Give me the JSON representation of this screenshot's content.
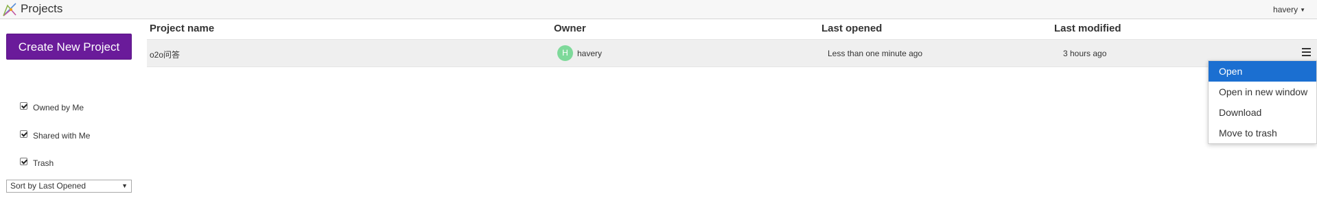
{
  "header": {
    "title": "Projects",
    "user": "havery",
    "logo_icon": "projects-logo-icon"
  },
  "sidebar": {
    "create_button": "Create New Project",
    "filters": [
      {
        "label": "Owned by Me",
        "checked": true
      },
      {
        "label": "Shared with Me",
        "checked": true
      },
      {
        "label": "Trash",
        "checked": true
      }
    ],
    "sort": {
      "selected": "Sort by Last Opened"
    }
  },
  "table": {
    "columns": [
      "Project name",
      "Owner",
      "Last opened",
      "Last modified"
    ],
    "rows": [
      {
        "name": "o2o问答",
        "owner_initial": "H",
        "owner": "havery",
        "last_opened": "Less than one minute ago",
        "last_modified": "3 hours ago"
      }
    ]
  },
  "row_menu": {
    "items": [
      "Open",
      "Open in new window",
      "Download",
      "Move to trash"
    ],
    "active_index": 0
  },
  "colors": {
    "accent": "#6a1b9a",
    "menu_highlight": "#1b6fd1",
    "avatar": "#7ed99a"
  }
}
